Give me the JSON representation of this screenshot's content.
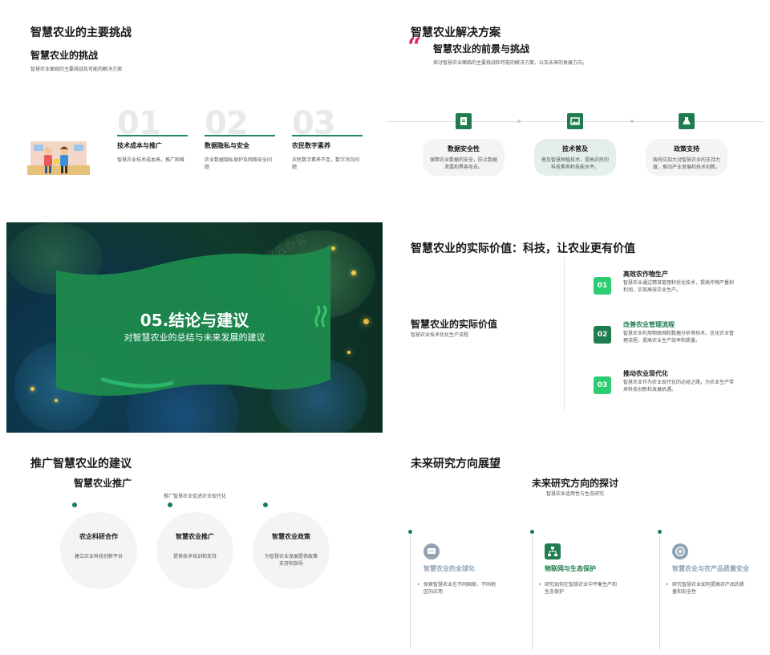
{
  "slide1": {
    "title": "智慧农业的主要挑战",
    "subtitle": "智慧农业的挑战",
    "desc": "智慧农业面临的主要挑战及可能的解决方案",
    "cards": [
      {
        "num": "01",
        "head": "技术成本与推广",
        "body": "智慧农业技术成本高，推广困难"
      },
      {
        "num": "02",
        "head": "数据隐私与安全",
        "body": "农业数据隐私保护及网络安全问题"
      },
      {
        "num": "03",
        "head": "农民数字素养",
        "body": "农民数字素养不足，数字鸿沟问题"
      }
    ]
  },
  "slide2": {
    "title": "智慧农业解决方案",
    "quote_mark": "“",
    "subtitle": "智慧农业的前景与挑战",
    "desc": "探讨智慧农业面临的主要挑战和可能的解决方案，以及未来的发展方向。",
    "cards": [
      {
        "head": "数据安全性",
        "body": "保障农业数据的安全，防止数据泄露和黑客攻击。",
        "icon": "document-icon"
      },
      {
        "head": "技术普及",
        "body": "普及智慧种植技术，提高农民的科技素养和技能水平。",
        "icon": "image-icon"
      },
      {
        "head": "政策支持",
        "body": "政府应加大对智慧农业的支持力度，推动产业发展和技术创新。",
        "icon": "flask-icon"
      }
    ]
  },
  "slide3": {
    "title": "05.结论与建议",
    "subtitle": "对智慧农业的总结与未来发展的建议",
    "watermark": "风云办公"
  },
  "slide4": {
    "title": "智慧农业的实际价值：科技，让农业更有价值",
    "left_head": "智慧农业的实际价值",
    "left_desc": "智慧农业技术优化生产流程",
    "items": [
      {
        "num": "01",
        "head": "高效农作物生产",
        "body": "智慧农业通过精准管理和优化技术，提高作物产量和利润，实现高效农业生产。",
        "color": "#2ecc71"
      },
      {
        "num": "02",
        "head": "改善农业管理流程",
        "body": "智慧农业利用物联网和数据分析等技术，优化农业管理流程，提高农业生产效率和质量。",
        "color": "#1e7d4f"
      },
      {
        "num": "03",
        "head": "推动农业现代化",
        "body": "智慧农业作为农业现代化的必经之路，为农业生产带来科技创新和发展机遇。",
        "color": "#2ecc71"
      }
    ]
  },
  "slide5": {
    "title": "推广智慧农业的建议",
    "subtitle": "智慧农业推广",
    "desc": "推广智慧农业促进农业现代化",
    "circles": [
      {
        "head": "农企科研合作",
        "body": "建立农业科技创新平台"
      },
      {
        "head": "智慧农业推广",
        "body": "提供技术培训和支持"
      },
      {
        "head": "智慧农业政策",
        "body": "为智慧农业发展提供政策支持和指导"
      }
    ]
  },
  "slide6": {
    "title": "未来研究方向展望",
    "subtitle": "未来研究方向的探讨",
    "desc": "智慧农业适用性与生态研究",
    "cols": [
      {
        "head": "智慧农业的全球化",
        "bullet": "探索智慧农业在不同国家、不同地区的应用",
        "color": "#8fa3b4",
        "icon": "chat-icon"
      },
      {
        "head": "物联网与生态保护",
        "bullet": "研究如何在智慧农业中平衡生产和生态保护",
        "color": "#1e7d4f",
        "icon": "network-icon"
      },
      {
        "head": "智慧农业与农产品质量安全",
        "bullet": "研究智慧农业如何提高农产品的质量和安全性",
        "color": "#8fa3b4",
        "icon": "target-icon"
      }
    ]
  }
}
